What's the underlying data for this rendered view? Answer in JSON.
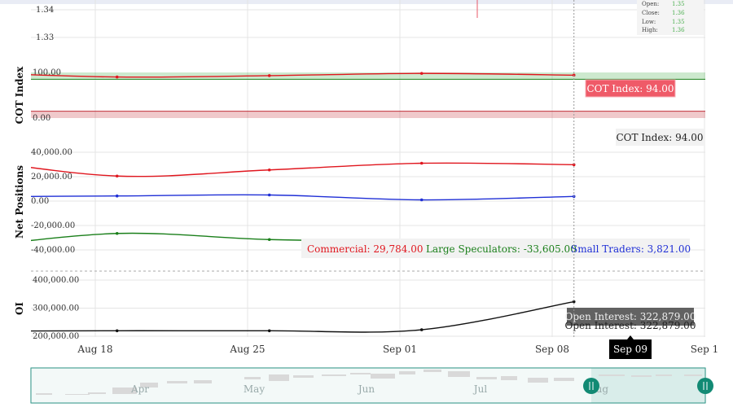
{
  "chart_data": {
    "type": "line",
    "x_dates": [
      "2025-08-12",
      "2025-08-19",
      "2025-08-26",
      "2025-09-02",
      "2025-09-09"
    ],
    "x_ticks": [
      "Aug 18",
      "Aug 25",
      "Sep 01",
      "Sep 08",
      "Sep 1"
    ],
    "x_tick_dates": [
      "2025-08-18",
      "2025-08-25",
      "2025-09-01",
      "2025-09-08",
      "2025-09-15"
    ],
    "cursor_label": "Sep 09",
    "price_panel": {
      "yticks": [
        "1.34",
        "1.33"
      ],
      "ohlc": {
        "open_label": "Open:",
        "open": "1.35",
        "close_label": "Close:",
        "close": "1.36",
        "low_label": "Low:",
        "low": "1.35",
        "high_label": "High:",
        "high": "1.36"
      }
    },
    "cot_panel": {
      "ylabel": "COT Index",
      "yticks": [
        "100.00",
        "0.00"
      ],
      "series": [
        {
          "name": "COT Index",
          "color": "#e0161e",
          "values": [
            100,
            90,
            93,
            98,
            94
          ]
        }
      ],
      "upper_band": [
        85,
        100
      ],
      "lower_band": [
        0,
        15
      ],
      "tooltip": "COT Index: 94.00",
      "label": "COT Index: 94.00"
    },
    "net_panel": {
      "ylabel": "Net Positions",
      "yticks": [
        "40,000.00",
        "20,000.00",
        "0.00",
        "-20,000.00",
        "-40,000.00"
      ],
      "series": [
        {
          "name": "Commercial",
          "color": "#e0161e",
          "values": [
            35000,
            20500,
            25500,
            31000,
            29784
          ],
          "label": "Commercial: 29,784.00"
        },
        {
          "name": "Large Speculators",
          "color": "#1a7f1a",
          "values": [
            -38500,
            -26500,
            -31500,
            -33000,
            -33605
          ],
          "label": "Large Speculators: -33,605.00"
        },
        {
          "name": "Small Traders",
          "color": "#1f2fd6",
          "values": [
            3500,
            4200,
            5000,
            1000,
            3821
          ],
          "label": "Small Traders: 3,821.00"
        }
      ]
    },
    "oi_panel": {
      "ylabel": "OI",
      "yticks": [
        "400,000.00",
        "300,000.00",
        "200,000.00"
      ],
      "series": [
        {
          "name": "Open Interest",
          "color": "#111111",
          "values": [
            218000,
            219500,
            219500,
            223000,
            322879
          ]
        }
      ],
      "tooltip": "Open Interest: 322,879.00",
      "label": "Open Interest: 322,879.00"
    },
    "navigator": {
      "labels": [
        "Apr",
        "May",
        "Jun",
        "Jul",
        "Aug"
      ]
    }
  }
}
